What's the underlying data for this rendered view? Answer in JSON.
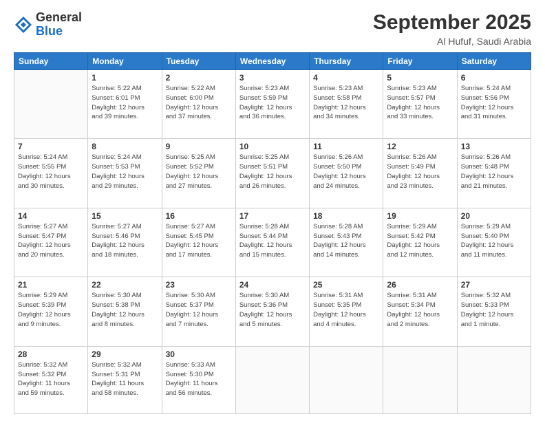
{
  "header": {
    "logo_general": "General",
    "logo_blue": "Blue",
    "month": "September 2025",
    "location": "Al Hufuf, Saudi Arabia"
  },
  "weekdays": [
    "Sunday",
    "Monday",
    "Tuesday",
    "Wednesday",
    "Thursday",
    "Friday",
    "Saturday"
  ],
  "weeks": [
    [
      {
        "day": "",
        "info": ""
      },
      {
        "day": "1",
        "info": "Sunrise: 5:22 AM\nSunset: 6:01 PM\nDaylight: 12 hours\nand 39 minutes."
      },
      {
        "day": "2",
        "info": "Sunrise: 5:22 AM\nSunset: 6:00 PM\nDaylight: 12 hours\nand 37 minutes."
      },
      {
        "day": "3",
        "info": "Sunrise: 5:23 AM\nSunset: 5:59 PM\nDaylight: 12 hours\nand 36 minutes."
      },
      {
        "day": "4",
        "info": "Sunrise: 5:23 AM\nSunset: 5:58 PM\nDaylight: 12 hours\nand 34 minutes."
      },
      {
        "day": "5",
        "info": "Sunrise: 5:23 AM\nSunset: 5:57 PM\nDaylight: 12 hours\nand 33 minutes."
      },
      {
        "day": "6",
        "info": "Sunrise: 5:24 AM\nSunset: 5:56 PM\nDaylight: 12 hours\nand 31 minutes."
      }
    ],
    [
      {
        "day": "7",
        "info": "Sunrise: 5:24 AM\nSunset: 5:55 PM\nDaylight: 12 hours\nand 30 minutes."
      },
      {
        "day": "8",
        "info": "Sunrise: 5:24 AM\nSunset: 5:53 PM\nDaylight: 12 hours\nand 29 minutes."
      },
      {
        "day": "9",
        "info": "Sunrise: 5:25 AM\nSunset: 5:52 PM\nDaylight: 12 hours\nand 27 minutes."
      },
      {
        "day": "10",
        "info": "Sunrise: 5:25 AM\nSunset: 5:51 PM\nDaylight: 12 hours\nand 26 minutes."
      },
      {
        "day": "11",
        "info": "Sunrise: 5:26 AM\nSunset: 5:50 PM\nDaylight: 12 hours\nand 24 minutes."
      },
      {
        "day": "12",
        "info": "Sunrise: 5:26 AM\nSunset: 5:49 PM\nDaylight: 12 hours\nand 23 minutes."
      },
      {
        "day": "13",
        "info": "Sunrise: 5:26 AM\nSunset: 5:48 PM\nDaylight: 12 hours\nand 21 minutes."
      }
    ],
    [
      {
        "day": "14",
        "info": "Sunrise: 5:27 AM\nSunset: 5:47 PM\nDaylight: 12 hours\nand 20 minutes."
      },
      {
        "day": "15",
        "info": "Sunrise: 5:27 AM\nSunset: 5:46 PM\nDaylight: 12 hours\nand 18 minutes."
      },
      {
        "day": "16",
        "info": "Sunrise: 5:27 AM\nSunset: 5:45 PM\nDaylight: 12 hours\nand 17 minutes."
      },
      {
        "day": "17",
        "info": "Sunrise: 5:28 AM\nSunset: 5:44 PM\nDaylight: 12 hours\nand 15 minutes."
      },
      {
        "day": "18",
        "info": "Sunrise: 5:28 AM\nSunset: 5:43 PM\nDaylight: 12 hours\nand 14 minutes."
      },
      {
        "day": "19",
        "info": "Sunrise: 5:29 AM\nSunset: 5:42 PM\nDaylight: 12 hours\nand 12 minutes."
      },
      {
        "day": "20",
        "info": "Sunrise: 5:29 AM\nSunset: 5:40 PM\nDaylight: 12 hours\nand 11 minutes."
      }
    ],
    [
      {
        "day": "21",
        "info": "Sunrise: 5:29 AM\nSunset: 5:39 PM\nDaylight: 12 hours\nand 9 minutes."
      },
      {
        "day": "22",
        "info": "Sunrise: 5:30 AM\nSunset: 5:38 PM\nDaylight: 12 hours\nand 8 minutes."
      },
      {
        "day": "23",
        "info": "Sunrise: 5:30 AM\nSunset: 5:37 PM\nDaylight: 12 hours\nand 7 minutes."
      },
      {
        "day": "24",
        "info": "Sunrise: 5:30 AM\nSunset: 5:36 PM\nDaylight: 12 hours\nand 5 minutes."
      },
      {
        "day": "25",
        "info": "Sunrise: 5:31 AM\nSunset: 5:35 PM\nDaylight: 12 hours\nand 4 minutes."
      },
      {
        "day": "26",
        "info": "Sunrise: 5:31 AM\nSunset: 5:34 PM\nDaylight: 12 hours\nand 2 minutes."
      },
      {
        "day": "27",
        "info": "Sunrise: 5:32 AM\nSunset: 5:33 PM\nDaylight: 12 hours\nand 1 minute."
      }
    ],
    [
      {
        "day": "28",
        "info": "Sunrise: 5:32 AM\nSunset: 5:32 PM\nDaylight: 11 hours\nand 59 minutes."
      },
      {
        "day": "29",
        "info": "Sunrise: 5:32 AM\nSunset: 5:31 PM\nDaylight: 11 hours\nand 58 minutes."
      },
      {
        "day": "30",
        "info": "Sunrise: 5:33 AM\nSunset: 5:30 PM\nDaylight: 11 hours\nand 56 minutes."
      },
      {
        "day": "",
        "info": ""
      },
      {
        "day": "",
        "info": ""
      },
      {
        "day": "",
        "info": ""
      },
      {
        "day": "",
        "info": ""
      }
    ]
  ]
}
